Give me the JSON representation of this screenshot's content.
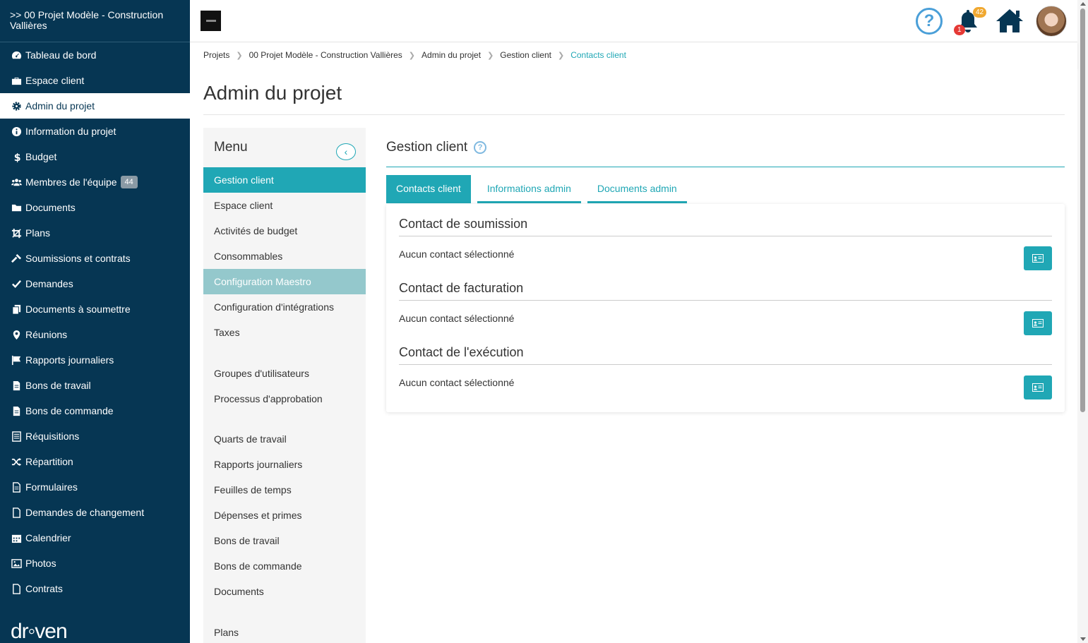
{
  "sidebar": {
    "project_title": ">> 00 Projet Modèle - Construction Vallières",
    "items": [
      {
        "label": "Tableau de bord",
        "icon": "dashboard-icon"
      },
      {
        "label": "Espace client",
        "icon": "briefcase-icon"
      },
      {
        "label": "Admin du projet",
        "icon": "gear-icon",
        "active": true
      },
      {
        "label": "Information du projet",
        "icon": "info-icon"
      },
      {
        "label": "Budget",
        "icon": "dollar-icon"
      },
      {
        "label": "Membres de l'équipe",
        "icon": "users-icon",
        "badge": "44"
      },
      {
        "label": "Documents",
        "icon": "folder-icon"
      },
      {
        "label": "Plans",
        "icon": "crop-icon"
      },
      {
        "label": "Soumissions et contrats",
        "icon": "hammer-icon"
      },
      {
        "label": "Demandes",
        "icon": "check-icon"
      },
      {
        "label": "Documents à soumettre",
        "icon": "copy-icon"
      },
      {
        "label": "Réunions",
        "icon": "map-pin-icon"
      },
      {
        "label": "Rapports journaliers",
        "icon": "flag-icon"
      },
      {
        "label": "Bons de travail",
        "icon": "file-icon"
      },
      {
        "label": "Bons de commande",
        "icon": "file-icon"
      },
      {
        "label": "Réquisitions",
        "icon": "list-icon"
      },
      {
        "label": "Répartition",
        "icon": "shuffle-icon"
      },
      {
        "label": "Formulaires",
        "icon": "file-text-icon"
      },
      {
        "label": "Demandes de changement",
        "icon": "file-outline-icon"
      },
      {
        "label": "Calendrier",
        "icon": "calendar-icon"
      },
      {
        "label": "Photos",
        "icon": "image-icon"
      },
      {
        "label": "Contrats",
        "icon": "file-outline-icon"
      }
    ],
    "logo_text": "dr◦ven"
  },
  "topbar": {
    "help_icon": "question-circle-icon",
    "notification_count": "42",
    "alert_count": "1",
    "home_icon": "home-icon"
  },
  "breadcrumb": [
    "Projets",
    "00 Projet Modèle - Construction Vallières",
    "Admin du projet",
    "Gestion client",
    "Contacts client"
  ],
  "page": {
    "title": "Admin du projet"
  },
  "submenu": {
    "title": "Menu",
    "groups": [
      [
        "Gestion client",
        "Espace client",
        "Activités de budget",
        "Consommables",
        "Configuration Maestro",
        "Configuration d'intégrations",
        "Taxes"
      ],
      [
        "Groupes d'utilisateurs",
        "Processus d'approbation"
      ],
      [
        "Quarts de travail",
        "Rapports journaliers",
        "Feuilles de temps",
        "Dépenses et primes",
        "Bons de travail",
        "Bons de commande",
        "Documents"
      ],
      [
        "Plans"
      ]
    ]
  },
  "content": {
    "title": "Gestion client",
    "tabs": [
      "Contacts client",
      "Informations admin",
      "Documents admin"
    ],
    "sections": [
      {
        "title": "Contact de soumission",
        "text": "Aucun contact sélectionné"
      },
      {
        "title": "Contact de facturation",
        "text": "Aucun contact sélectionné"
      },
      {
        "title": "Contact de l'exécution",
        "text": "Aucun contact sélectionné"
      }
    ]
  },
  "colors": {
    "sidebar_bg": "#063653",
    "accent": "#20a7b5",
    "accent_light": "#94c8cc",
    "badge_orange": "#f0a830",
    "badge_red": "#e53935"
  }
}
